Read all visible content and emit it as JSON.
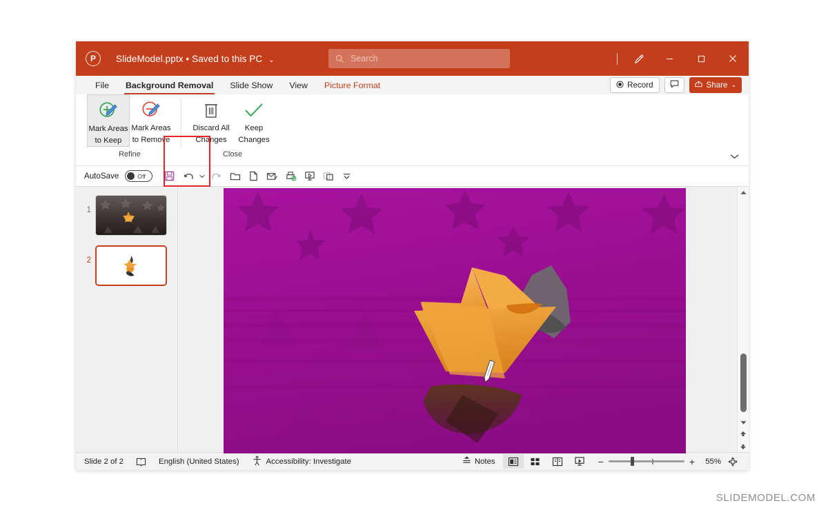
{
  "titlebar": {
    "logo": "powerpoint-logo",
    "document_name": "SlideModel.pptx",
    "save_state": "• Saved to this PC",
    "chevron": "⌄",
    "search_placeholder": "Search",
    "search_value": "",
    "pen_icon": "pen-icon",
    "minimize": "−",
    "maximize": "□",
    "close": "✕",
    "accent_color": "#c43e1c"
  },
  "tabs": [
    {
      "label": "File",
      "active": false,
      "accent": false
    },
    {
      "label": "Background Removal",
      "active": true,
      "accent": false
    },
    {
      "label": "Slide Show",
      "active": false,
      "accent": false
    },
    {
      "label": "View",
      "active": false,
      "accent": false
    },
    {
      "label": "Picture Format",
      "active": false,
      "accent": true
    }
  ],
  "tab_actions": {
    "record_label": "Record",
    "comments_icon": "comment-icon",
    "share_label": "Share",
    "share_chevron": "⌄",
    "share_icon": "share-icon"
  },
  "ribbon": {
    "collapse_icon": "chevron-down-icon",
    "groups": [
      {
        "name": "Refine",
        "buttons": [
          {
            "label_line1": "Mark Areas",
            "label_line2": "to Keep",
            "icon": "mark-keep-icon",
            "selected": true
          },
          {
            "label_line1": "Mark Areas",
            "label_line2": "to Remove",
            "icon": "mark-remove-icon",
            "selected": false
          }
        ]
      },
      {
        "name": "Close",
        "buttons": [
          {
            "label_line1": "Discard All",
            "label_line2": "Changes",
            "icon": "trash-icon",
            "selected": false
          },
          {
            "label_line1": "Keep",
            "label_line2": "Changes",
            "icon": "checkmark-icon",
            "selected": false
          }
        ]
      }
    ]
  },
  "quick_access": {
    "autosave_label": "AutoSave",
    "autosave_state": "Off",
    "buttons": [
      {
        "icon": "save-icon"
      },
      {
        "icon": "undo-icon"
      },
      {
        "icon": "undo-dropdown-icon"
      },
      {
        "icon": "redo-icon"
      },
      {
        "icon": "open-folder-icon"
      },
      {
        "icon": "new-file-icon"
      },
      {
        "icon": "email-icon"
      },
      {
        "icon": "quick-print-icon"
      },
      {
        "icon": "start-slideshow-icon"
      },
      {
        "icon": "duplicate-icon"
      },
      {
        "icon": "customize-toolbar-icon"
      }
    ]
  },
  "thumbnails": [
    {
      "number": "1",
      "active": false,
      "description": "dark star background with orange paper boat"
    },
    {
      "number": "2",
      "active": true,
      "description": "white background with orange paper boat cutout"
    }
  ],
  "canvas": {
    "description": "background removal preview: magenta overlay marks removal areas, orange origami paper boat preserved",
    "overlay_color": "#a0149b",
    "boat_color": "#f0a040",
    "cursor_icon": "pencil-cursor"
  },
  "scrollbar": {
    "up_arrow": "▲",
    "down_arrow": "▼",
    "previous_slide": "⬆",
    "next_slide": "⬇"
  },
  "statusbar": {
    "slide_indicator": "Slide 2 of 2",
    "spelling_icon": "spellcheck-icon",
    "language": "English (United States)",
    "accessibility_icon": "accessibility-icon",
    "accessibility_text": "Accessibility: Investigate",
    "notes_label": "Notes",
    "notes_icon": "notes-icon",
    "views": [
      {
        "icon": "normal-view-icon",
        "active": true
      },
      {
        "icon": "slide-sorter-icon",
        "active": false
      },
      {
        "icon": "reading-view-icon",
        "active": false
      },
      {
        "icon": "slideshow-view-icon",
        "active": false
      }
    ],
    "zoom_out": "−",
    "zoom_in": "+",
    "zoom_level": "55%",
    "fit_icon": "fit-to-window-icon"
  },
  "watermark": "SLIDEMODEL.COM"
}
